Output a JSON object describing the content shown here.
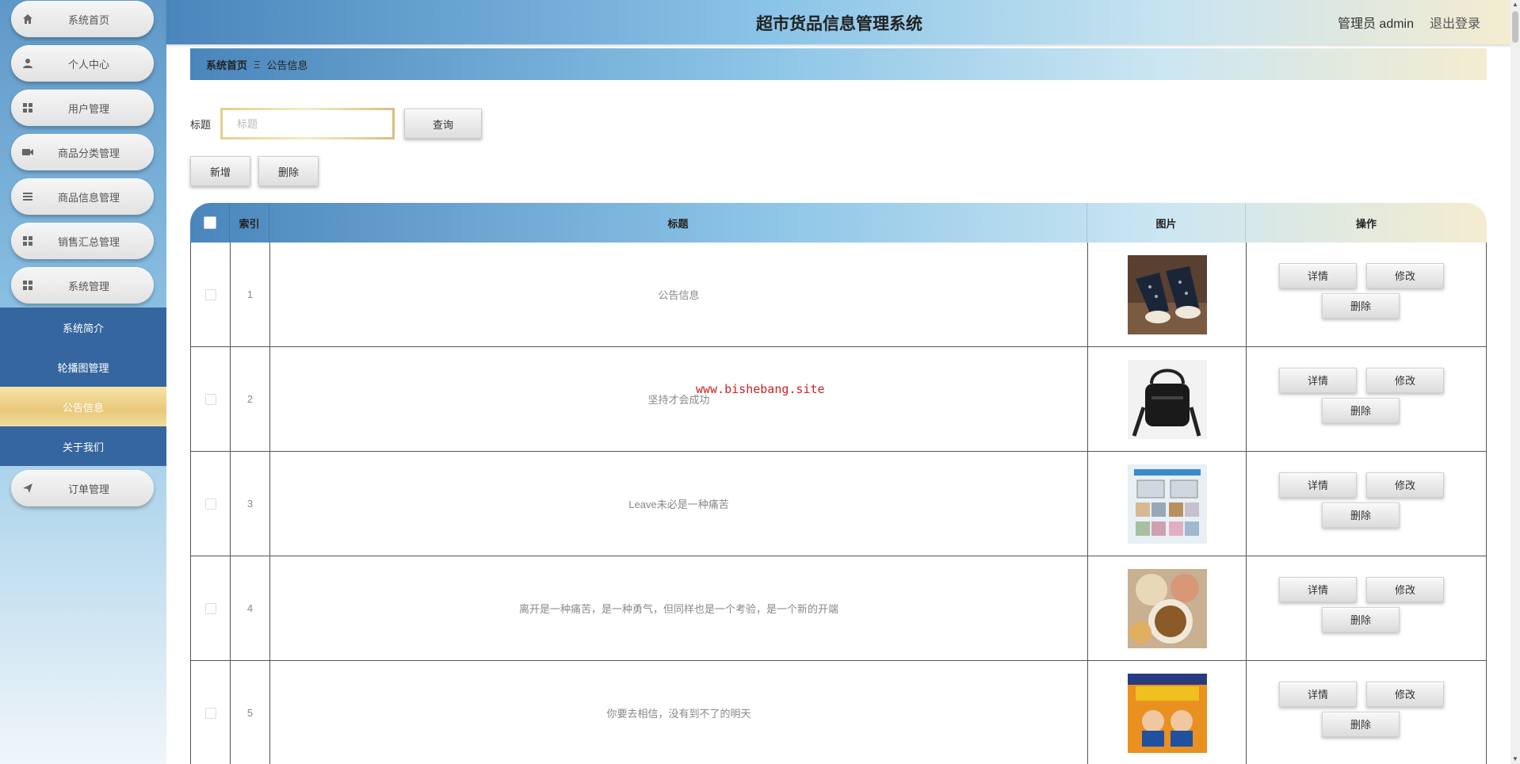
{
  "header": {
    "title": "超市货品信息管理系统",
    "user": "管理员 admin",
    "logout": "退出登录"
  },
  "sidebar": {
    "items": [
      {
        "label": "系统首页",
        "icon": "home-icon"
      },
      {
        "label": "个人中心",
        "icon": "user-icon"
      },
      {
        "label": "用户管理",
        "icon": "grid-icon"
      },
      {
        "label": "商品分类管理",
        "icon": "camera-icon"
      },
      {
        "label": "商品信息管理",
        "icon": "list-icon"
      },
      {
        "label": "销售汇总管理",
        "icon": "grid-icon"
      },
      {
        "label": "系统管理",
        "icon": "grid-icon"
      }
    ],
    "submenu": [
      {
        "label": "系统简介"
      },
      {
        "label": "轮播图管理"
      },
      {
        "label": "公告信息",
        "active": true
      },
      {
        "label": "关于我们"
      }
    ],
    "last_item": {
      "label": "订单管理",
      "icon": "send-icon"
    }
  },
  "breadcrumb": {
    "home": "系统首页",
    "separator": "Ξ",
    "current": "公告信息"
  },
  "search": {
    "label": "标题",
    "placeholder": "标题",
    "query_button": "查询"
  },
  "actions": {
    "add": "新增",
    "delete": "删除"
  },
  "table": {
    "headers": {
      "index": "索引",
      "title": "标题",
      "image": "图片",
      "ops": "操作"
    },
    "rows": [
      {
        "index": "1",
        "title": "公告信息",
        "image": "shoes-photo"
      },
      {
        "index": "2",
        "title": "坚持才会成功",
        "image": "bag-photo"
      },
      {
        "index": "3",
        "title": "Leave未必是一种痛苦",
        "image": "storage-box-photo"
      },
      {
        "index": "4",
        "title": "离开是一种痛苦，是一种勇气，但同样也是一个考验，是一个新的开端",
        "image": "food-photo"
      },
      {
        "index": "5",
        "title": "你要去相信，没有到不了的明天",
        "image": "poster-photo"
      }
    ],
    "row_buttons": {
      "detail": "详情",
      "edit": "修改",
      "delete": "删除"
    }
  },
  "watermark": "www.bishebang.site",
  "colors": {
    "primary_blue": "#4a86bc",
    "gold": "#e8c878",
    "submenu_blue": "#3566a0"
  }
}
